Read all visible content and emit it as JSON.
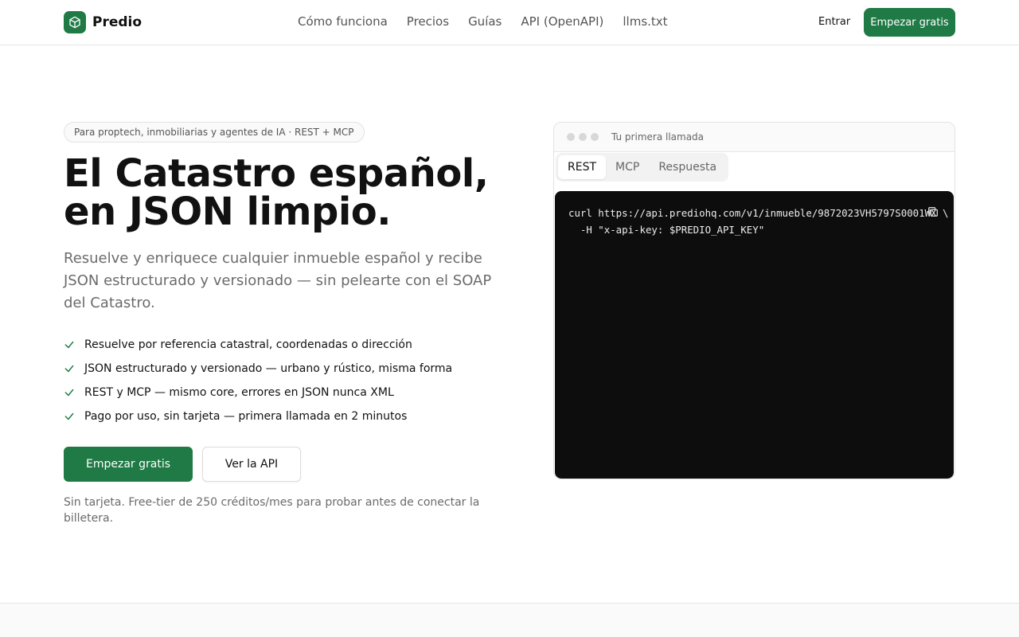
{
  "brand": {
    "name": "Predio",
    "accent": "#1f7a45"
  },
  "nav": {
    "items": [
      "Cómo funciona",
      "Precios",
      "Guías",
      "API (OpenAPI)",
      "llms.txt"
    ],
    "login_label": "Entrar",
    "cta_label": "Empezar gratis"
  },
  "hero": {
    "badge": "Para proptech, inmobiliarias y agentes de IA · REST + MCP",
    "headline_line1": "El Catastro español,",
    "headline_line2": "en JSON limpio.",
    "subheadline": "Resuelve y enriquece cualquier inmueble español y recibe JSON estructurado y versionado — sin pelearte con el SOAP del Catastro.",
    "features": [
      "Resuelve por referencia catastral, coordenadas o dirección",
      "JSON estructurado y versionado — urbano y rústico, misma forma",
      "REST y MCP — mismo core, errores en JSON nunca XML",
      "Pago por uso, sin tarjeta — primera llamada en 2 minutos"
    ],
    "primary_button": "Empezar gratis",
    "secondary_button": "Ver la API",
    "fine_print": "Sin tarjeta. Free-tier de 250 créditos/mes para probar antes de conectar la billetera."
  },
  "code_card": {
    "title": "Tu primera llamada",
    "tabs": [
      "REST",
      "MCP",
      "Respuesta"
    ],
    "active_tab": "REST",
    "code_line1": "curl https://api.prediohq.com/v1/inmueble/9872023VH5797S0001WX \\",
    "code_line2": "  -H \"x-api-key: $PREDIO_API_KEY\"",
    "copy_icon": "copy-icon"
  }
}
